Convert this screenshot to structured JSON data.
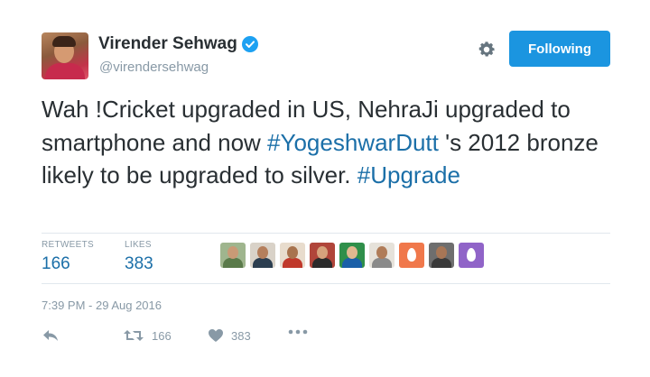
{
  "author": {
    "name": "Virender Sehwag",
    "handle": "@virendersehwag",
    "verified": true
  },
  "follow_button": {
    "label": "Following",
    "color": "#1b95e0"
  },
  "tweet": {
    "segments": [
      {
        "text": "Wah !Cricket upgraded in US, NehraJi upgraded to smartphone and now ",
        "type": "text"
      },
      {
        "text": "#YogeshwarDutt",
        "type": "hashtag"
      },
      {
        "text": " 's 2012 bronze likely to be upgraded to silver. ",
        "type": "text"
      },
      {
        "text": "#Upgrade",
        "type": "hashtag"
      }
    ]
  },
  "stats": {
    "retweets_label": "RETWEETS",
    "retweets_value": "166",
    "likes_label": "LIKES",
    "likes_value": "383"
  },
  "likers": [
    {
      "bg": "#9fb58e",
      "skin": "#c99a76",
      "body": "#5a7a4a"
    },
    {
      "bg": "#d9d2c8",
      "skin": "#b57f5c",
      "body": "#2c3e50"
    },
    {
      "bg": "#e8dccd",
      "skin": "#a8734e",
      "body": "#c0392b"
    },
    {
      "bg": "#b0453a",
      "skin": "#d6a27c",
      "body": "#2b2b2b"
    },
    {
      "bg": "#2f8f4a",
      "skin": "#e0b890",
      "body": "#1a5fa8"
    },
    {
      "bg": "#e6e2da",
      "skin": "#b07c58",
      "body": "#8a8a8a"
    },
    {
      "bg": "#f0784b",
      "egg": true
    },
    {
      "bg": "#6e6e6e",
      "skin": "#a77656",
      "body": "#3a3a3a"
    },
    {
      "bg": "#9064c8",
      "egg": true
    }
  ],
  "timestamp": "7:39 PM - 29 Aug 2016",
  "actions": {
    "reply_icon": "reply-icon",
    "retweet_count": "166",
    "like_count": "383",
    "more_icon": "more-icon"
  },
  "colors": {
    "link": "#1b6fa8",
    "muted": "#8899a6",
    "verified": "#1da1f2"
  }
}
